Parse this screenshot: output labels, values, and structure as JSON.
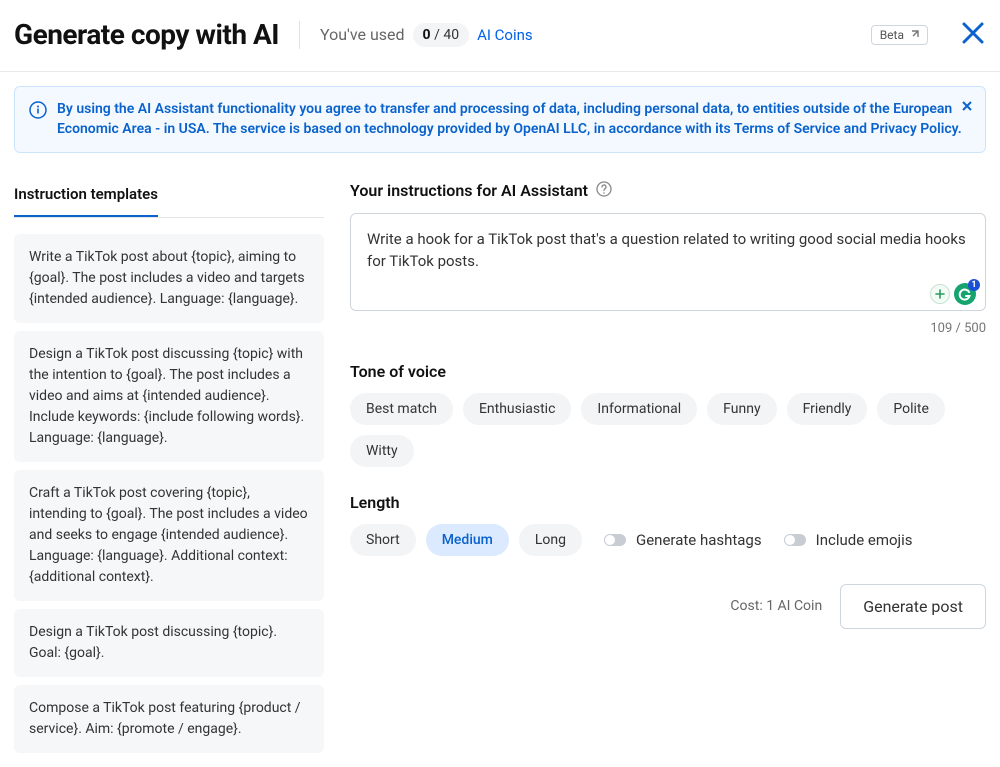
{
  "header": {
    "title": "Generate copy with AI",
    "usage_label": "You've used",
    "usage_current": "0",
    "usage_sep": "/",
    "usage_total": "40",
    "ai_coins": "AI Coins",
    "beta": "Beta"
  },
  "notice": {
    "text": "By using the AI Assistant functionality you agree to transfer and processing of data, including personal data, to entities outside of the European Economic Area - in USA. The service is based on technology provided by OpenAI LLC, in accordance with its Terms of Service and Privacy Policy."
  },
  "sidebar": {
    "tab_label": "Instruction templates",
    "templates": [
      "Write a TikTok post about {topic}, aiming to {goal}. The post includes a video and targets {intended audience}. Language: {language}.",
      "Design a TikTok post discussing {topic} with the intention to {goal}. The post includes a video and aims at {intended audience}. Include keywords: {include following words}. Language: {language}.",
      "Craft a TikTok post covering {topic}, intending to {goal}. The post includes a video and seeks to engage {intended audience}. Language: {language}. Additional context: {additional context}.",
      "Design a TikTok post discussing {topic}. Goal: {goal}.",
      "Compose a TikTok post featuring {product / service}. Aim: {promote / engage}."
    ]
  },
  "main": {
    "instructions_label": "Your instructions for AI Assistant",
    "instructions_value": "Write a hook for a TikTok post that's a question related to writing good social media hooks for TikTok posts.",
    "counter": "109 / 500",
    "tone_label": "Tone of voice",
    "tones": [
      "Best match",
      "Enthusiastic",
      "Informational",
      "Funny",
      "Friendly",
      "Polite",
      "Witty"
    ],
    "length_label": "Length",
    "lengths": [
      "Short",
      "Medium",
      "Long"
    ],
    "length_selected_index": 1,
    "toggle_hashtags": "Generate hashtags",
    "toggle_emojis": "Include emojis",
    "cost_label": "Cost: 1 AI Coin",
    "generate_btn": "Generate post",
    "badge_count": "1"
  }
}
